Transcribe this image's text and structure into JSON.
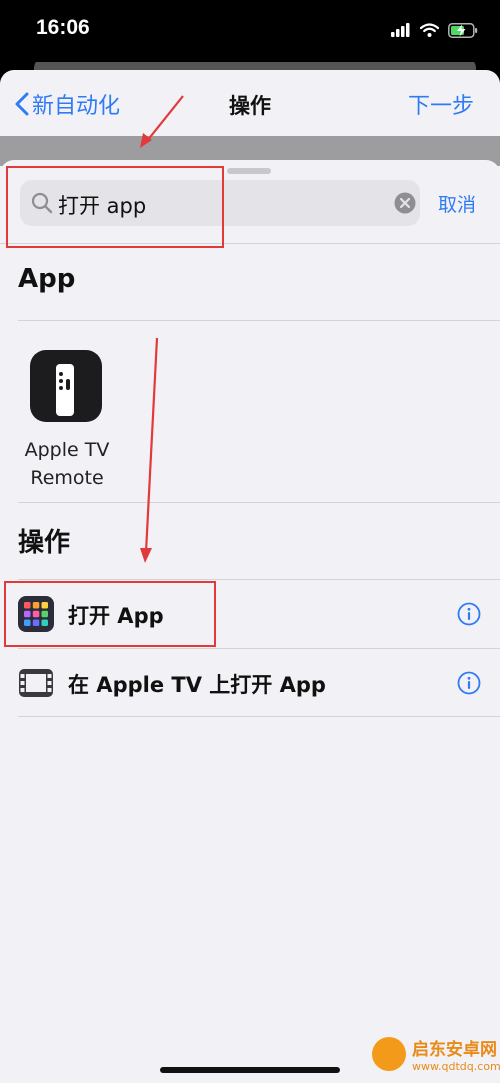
{
  "status_bar": {
    "time": "16:06"
  },
  "nav": {
    "back_label": "新自动化",
    "title": "操作",
    "next_label": "下一步"
  },
  "search": {
    "value": "打开 app",
    "cancel_label": "取消"
  },
  "sections": {
    "apps_title": "App",
    "actions_title": "操作"
  },
  "apps": [
    {
      "name_line1": "Apple TV",
      "name_line2": "Remote",
      "icon": "apple-tv-remote-icon"
    }
  ],
  "actions": [
    {
      "label": "打开 App",
      "icon": "app-grid-icon"
    },
    {
      "label": "在 Apple TV 上打开 App",
      "icon": "tv-frame-icon"
    }
  ],
  "watermark": {
    "brand": "启东安卓网",
    "url": "www.qdtdq.com"
  },
  "colors": {
    "accent": "#2f7bf5",
    "annotation": "#e23a3a",
    "sheet_bg": "#f2f2f6"
  }
}
